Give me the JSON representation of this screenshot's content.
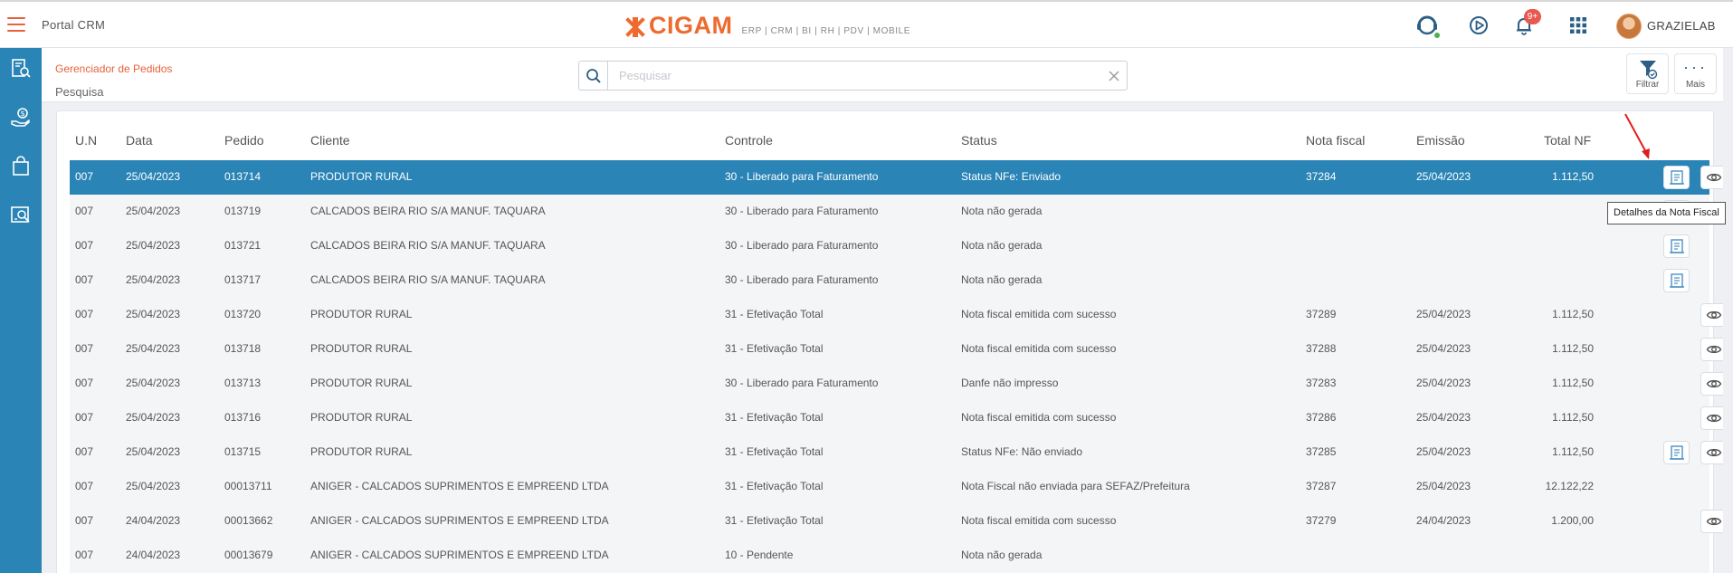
{
  "topbar": {
    "portal_title": "Portal CRM",
    "brand_name": "CIGAM",
    "brand_tagline": "ERP | CRM | BI | RH | PDV | MOBILE",
    "notification_count": "9+",
    "username": "GRAZIELAB"
  },
  "header": {
    "breadcrumb": "Gerenciador de Pedidos",
    "page_title": "Pesquisa",
    "search_placeholder": "Pesquisar",
    "filter_label": "Filtrar",
    "more_label": "Mais"
  },
  "table": {
    "columns": [
      "U.N",
      "Data",
      "Pedido",
      "Cliente",
      "Controle",
      "Status",
      "Nota fiscal",
      "Emissão",
      "Total NF"
    ],
    "rows": [
      {
        "un": "007",
        "data": "25/04/2023",
        "pedido": "013714",
        "cliente": "PRODUTOR RURAL",
        "controle": "30 - Liberado para Faturamento",
        "status": "Status NFe: Enviado",
        "nota": "37284",
        "emissao": "25/04/2023",
        "total": "1.112,50",
        "selected": true,
        "buttons": [
          "nfe",
          "view"
        ]
      },
      {
        "un": "007",
        "data": "25/04/2023",
        "pedido": "013719",
        "cliente": "CALCADOS BEIRA RIO S/A MANUF. TAQUARA",
        "controle": "30 - Liberado para Faturamento",
        "status": "Nota não gerada",
        "nota": "",
        "emissao": "",
        "total": "",
        "buttons": [
          "nfe"
        ]
      },
      {
        "un": "007",
        "data": "25/04/2023",
        "pedido": "013721",
        "cliente": "CALCADOS BEIRA RIO S/A MANUF. TAQUARA",
        "controle": "30 - Liberado para Faturamento",
        "status": "Nota não gerada",
        "nota": "",
        "emissao": "",
        "total": "",
        "buttons": [
          "nfe"
        ]
      },
      {
        "un": "007",
        "data": "25/04/2023",
        "pedido": "013717",
        "cliente": "CALCADOS BEIRA RIO S/A MANUF. TAQUARA",
        "controle": "30 - Liberado para Faturamento",
        "status": "Nota não gerada",
        "nota": "",
        "emissao": "",
        "total": "",
        "buttons": [
          "nfe"
        ]
      },
      {
        "un": "007",
        "data": "25/04/2023",
        "pedido": "013720",
        "cliente": "PRODUTOR RURAL",
        "controle": "31 - Efetivação Total",
        "status": "Nota fiscal emitida com sucesso",
        "nota": "37289",
        "emissao": "25/04/2023",
        "total": "1.112,50",
        "buttons": [
          "view",
          "print"
        ]
      },
      {
        "un": "007",
        "data": "25/04/2023",
        "pedido": "013718",
        "cliente": "PRODUTOR RURAL",
        "controle": "31 - Efetivação Total",
        "status": "Nota fiscal emitida com sucesso",
        "nota": "37288",
        "emissao": "25/04/2023",
        "total": "1.112,50",
        "buttons": [
          "view",
          "print"
        ]
      },
      {
        "un": "007",
        "data": "25/04/2023",
        "pedido": "013713",
        "cliente": "PRODUTOR RURAL",
        "controle": "30 - Liberado para Faturamento",
        "status": "Danfe não impresso",
        "nota": "37283",
        "emissao": "25/04/2023",
        "total": "1.112,50",
        "buttons": [
          "view"
        ]
      },
      {
        "un": "007",
        "data": "25/04/2023",
        "pedido": "013716",
        "cliente": "PRODUTOR RURAL",
        "controle": "31 - Efetivação Total",
        "status": "Nota fiscal emitida com sucesso",
        "nota": "37286",
        "emissao": "25/04/2023",
        "total": "1.112,50",
        "buttons": [
          "view",
          "print"
        ]
      },
      {
        "un": "007",
        "data": "25/04/2023",
        "pedido": "013715",
        "cliente": "PRODUTOR RURAL",
        "controle": "31 - Efetivação Total",
        "status": "Status NFe: Não enviado",
        "nota": "37285",
        "emissao": "25/04/2023",
        "total": "1.112,50",
        "buttons": [
          "nfe",
          "view"
        ]
      },
      {
        "un": "007",
        "data": "25/04/2023",
        "pedido": "00013711",
        "cliente": "ANIGER - CALCADOS SUPRIMENTOS E EMPREEND LTDA",
        "controle": "31 - Efetivação Total",
        "status": "Nota Fiscal não enviada para SEFAZ/Prefeitura",
        "nota": "37287",
        "emissao": "25/04/2023",
        "total": "12.122,22",
        "buttons": []
      },
      {
        "un": "007",
        "data": "24/04/2023",
        "pedido": "00013662",
        "cliente": "ANIGER - CALCADOS SUPRIMENTOS E EMPREEND LTDA",
        "controle": "31 - Efetivação Total",
        "status": "Nota fiscal emitida com sucesso",
        "nota": "37279",
        "emissao": "24/04/2023",
        "total": "1.200,00",
        "buttons": [
          "view"
        ]
      },
      {
        "un": "007",
        "data": "24/04/2023",
        "pedido": "00013679",
        "cliente": "ANIGER - CALCADOS SUPRIMENTOS E EMPREEND LTDA",
        "controle": "10 - Pendente",
        "status": "Nota não gerada",
        "nota": "",
        "emissao": "",
        "total": "",
        "buttons": []
      }
    ]
  },
  "tooltip": "Detalhes da Nota Fiscal",
  "colors": {
    "accent": "#e8613c",
    "sidebar": "#2a84b6",
    "selected_row": "#2a84b6",
    "icon_blue": "#4a90c4"
  }
}
